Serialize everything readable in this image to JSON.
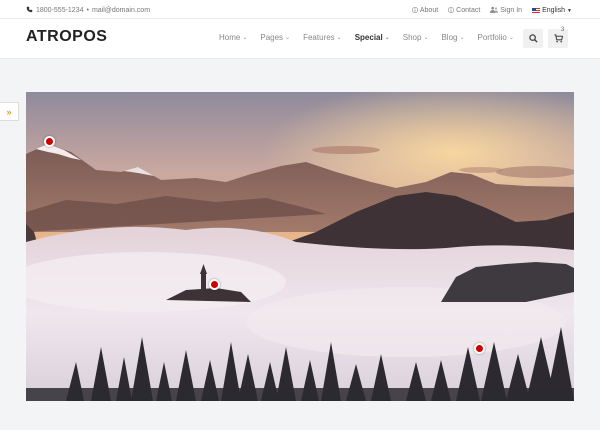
{
  "topbar": {
    "phone": "1800-555-1234",
    "separator": "•",
    "email": "mail@domain.com",
    "about": "About",
    "contact": "Contact",
    "sign_in": "Sign In",
    "language": "English"
  },
  "header": {
    "logo": "ATROPOS",
    "nav": [
      "Home",
      "Pages",
      "Features",
      "Special",
      "Shop",
      "Blog",
      "Portfolio"
    ],
    "active_nav": "Special",
    "cart_count": "3"
  },
  "hero": {
    "hotspot_count": 3
  },
  "colors": {
    "accent": "#e39b1b",
    "hotspot": "#cc0000"
  },
  "icons": [
    "phone-icon",
    "envelope-icon",
    "info-icon",
    "user-icon",
    "flag-icon",
    "search-icon",
    "cart-icon",
    "double-chevron-right-icon"
  ]
}
